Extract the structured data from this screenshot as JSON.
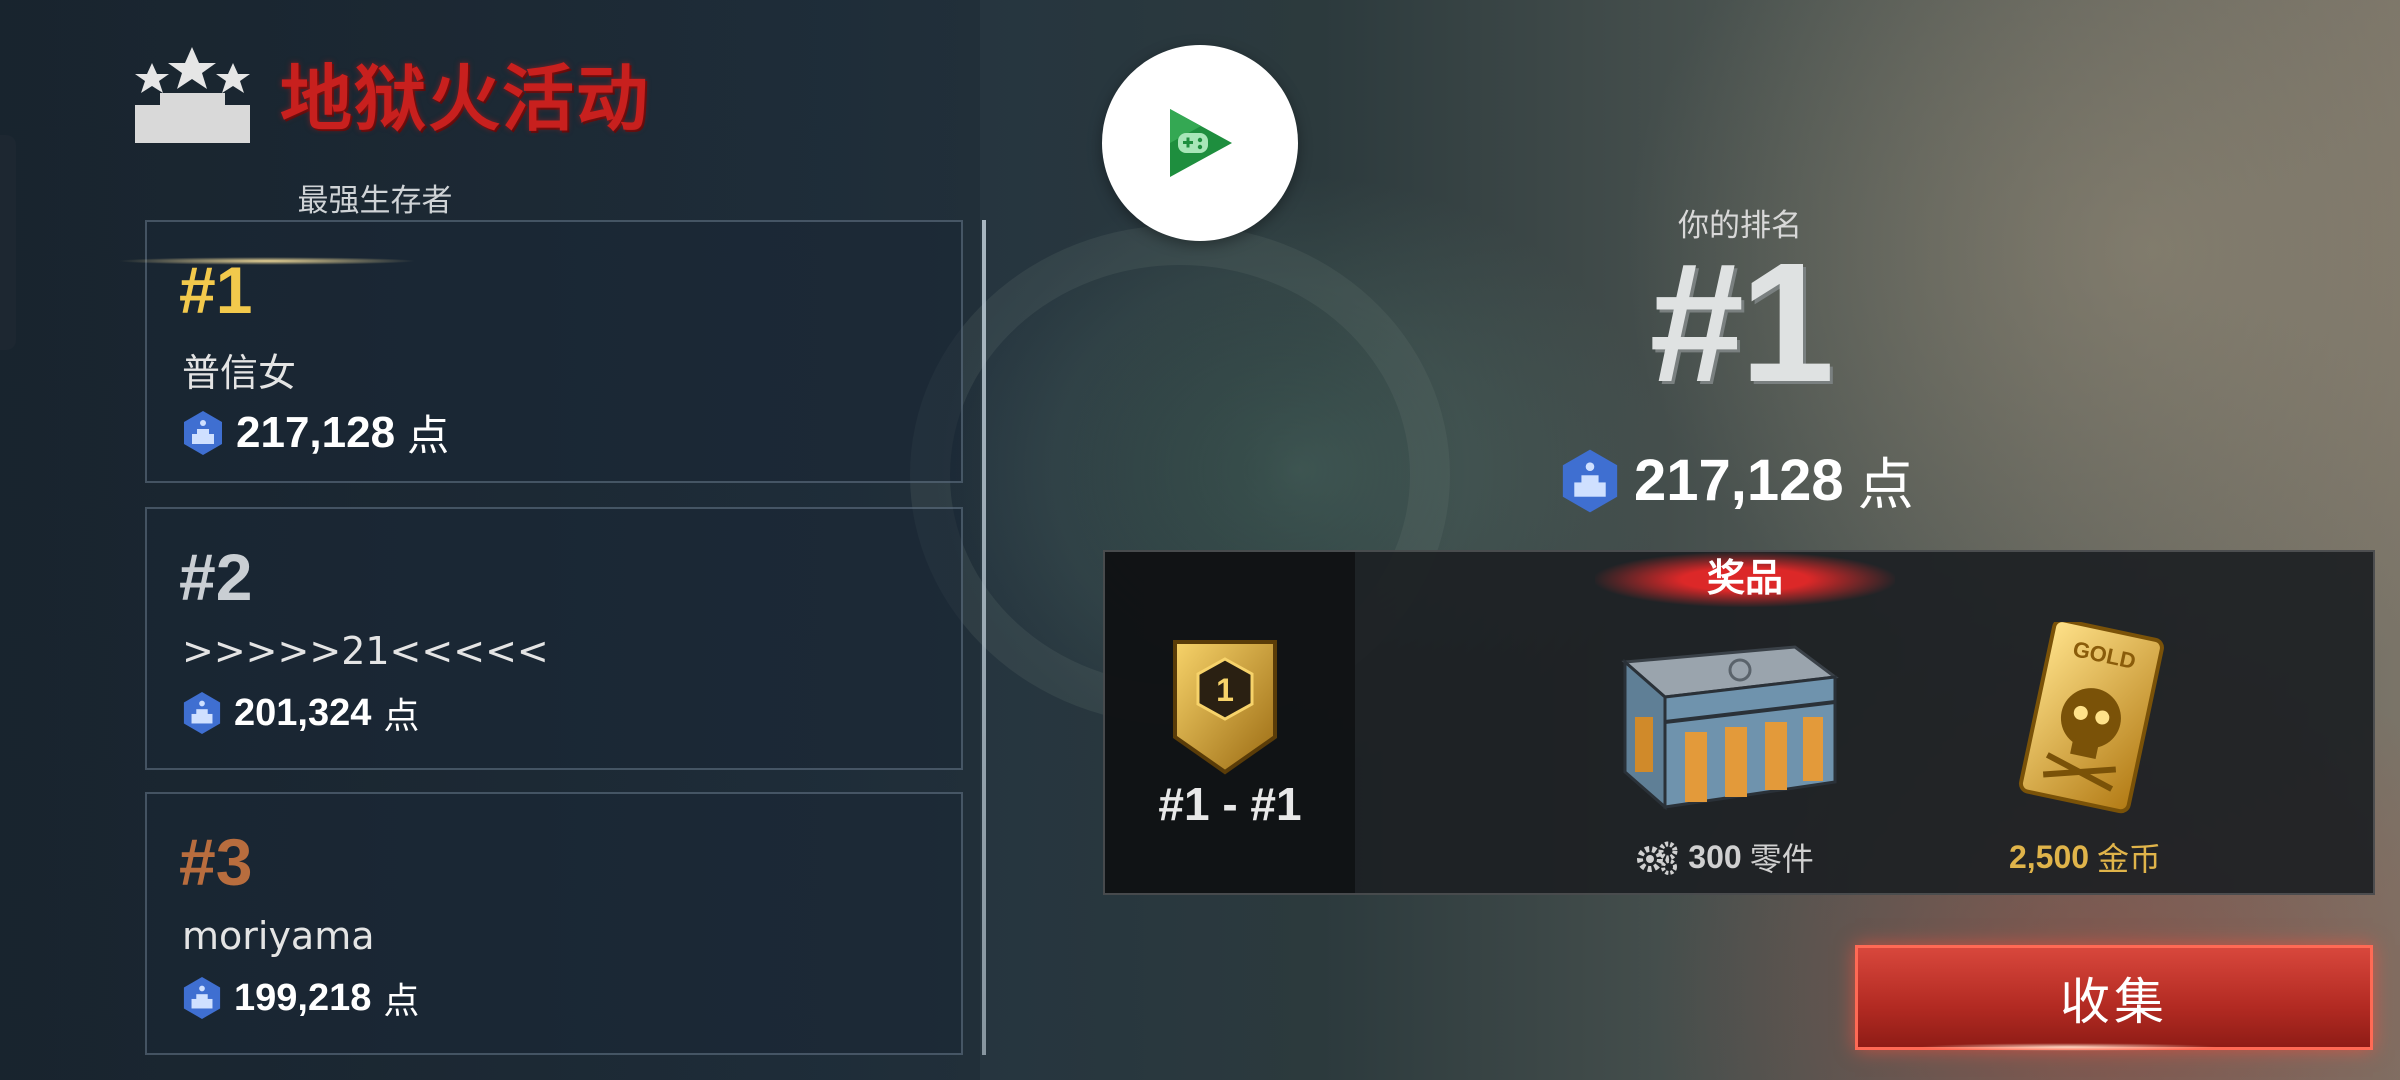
{
  "event": {
    "title": "地狱火活动",
    "section_label": "最强生存者"
  },
  "leaderboard": [
    {
      "rank": "#1",
      "name": "普信女",
      "score": "217,128",
      "unit": "点",
      "rank_color": "#f2c94c"
    },
    {
      "rank": "#2",
      "name": ">>>>>21<<<<<",
      "score": "201,324",
      "unit": "点",
      "rank_color": "#c9ced3"
    },
    {
      "rank": "#3",
      "name": "moriyama",
      "score": "199,218",
      "unit": "点",
      "rank_color": "#b86d3e"
    }
  ],
  "your_rank": {
    "label": "你的排名",
    "rank": "#1",
    "score": "217,128",
    "unit": "点"
  },
  "prizes": {
    "banner": "奖品",
    "tier_range": "#1 - #1",
    "tier_badge_number": "1",
    "items": [
      {
        "icon": "parts-crate-icon",
        "amount": "300",
        "label": "零件",
        "color": "#d0d0d0"
      },
      {
        "icon": "gold-card-icon",
        "amount": "2,500",
        "label": "金币",
        "color": "#e0b44a",
        "card_text": "GOLD"
      }
    ]
  },
  "collect_button": {
    "label": "收集"
  },
  "colors": {
    "accent_red": "#c8201e",
    "score_icon_blue": "#3f6fd1",
    "gold": "#e0b44a"
  }
}
